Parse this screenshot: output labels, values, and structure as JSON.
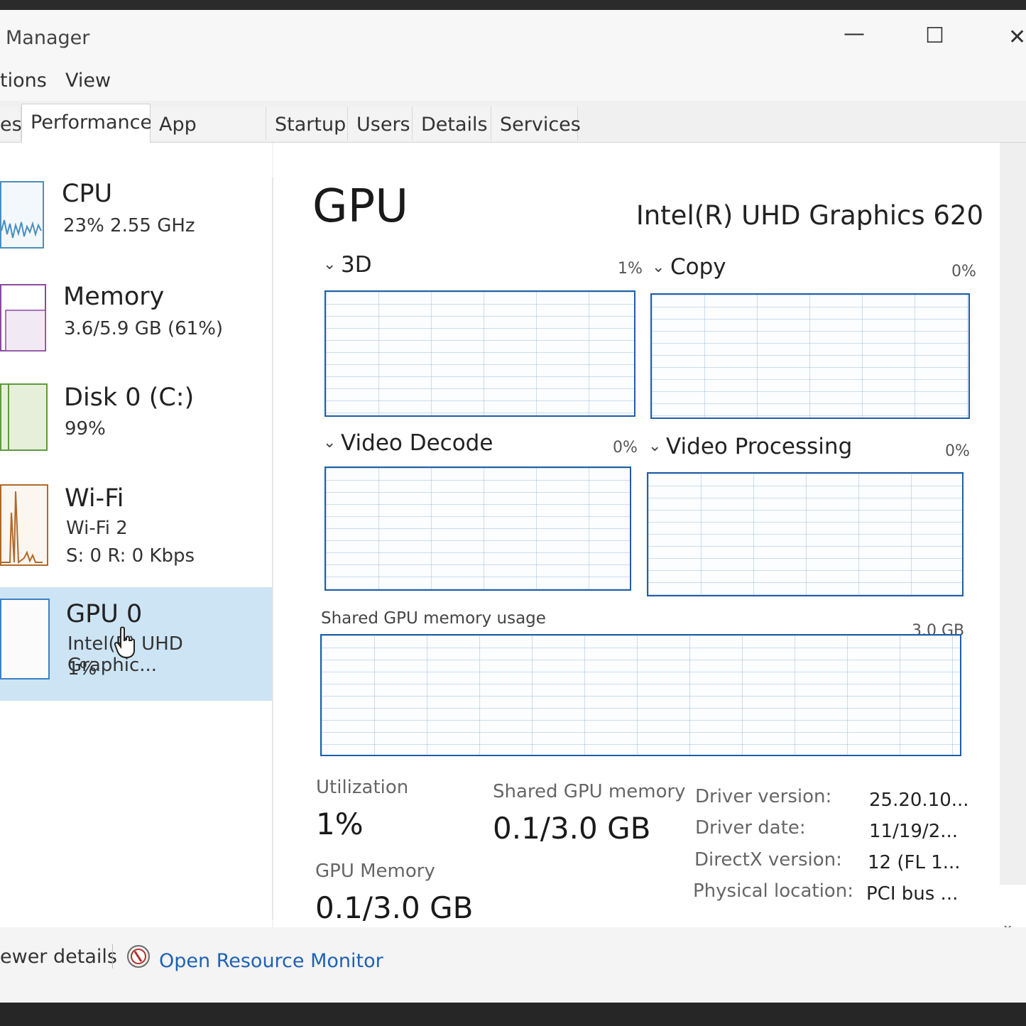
{
  "window": {
    "title": "Manager",
    "controls": {
      "minimize": "—",
      "maximize": "☐",
      "close": "✕"
    }
  },
  "menu": [
    "tions",
    "View"
  ],
  "tabs": [
    {
      "label": "es",
      "active": false
    },
    {
      "label": "Performance",
      "active": true
    },
    {
      "label": "App history",
      "active": false
    },
    {
      "label": "Startup",
      "active": false
    },
    {
      "label": "Users",
      "active": false
    },
    {
      "label": "Details",
      "active": false
    },
    {
      "label": "Services",
      "active": false
    }
  ],
  "sidebar": {
    "items": [
      {
        "name": "CPU",
        "sub1": "23%  2.55 GHz",
        "sub2": ""
      },
      {
        "name": "Memory",
        "sub1": "3.6/5.9 GB (61%)",
        "sub2": ""
      },
      {
        "name": "Disk 0 (C:)",
        "sub1": "99%",
        "sub2": ""
      },
      {
        "name": "Wi-Fi",
        "sub1": "Wi-Fi 2",
        "sub2": "S: 0 R: 0 Kbps"
      },
      {
        "name": "GPU 0",
        "sub1": "Intel(R) UHD Graphic...",
        "sub2": "1%"
      }
    ],
    "colors": {
      "cpu": "#4a8fc0",
      "memory": "#8a4aa0",
      "disk": "#5f9a3c",
      "wifi": "#b06a2a",
      "gpu": "#3b82c4",
      "selected": "#cde4f4"
    }
  },
  "main": {
    "title": "GPU",
    "model": "Intel(R) UHD Graphics 620",
    "engines": [
      {
        "label": "3D",
        "percent": "1%"
      },
      {
        "label": "Copy",
        "percent": "0%"
      },
      {
        "label": "Video Decode",
        "percent": "0%"
      },
      {
        "label": "Video Processing",
        "percent": "0%"
      }
    ],
    "shared_memory_graph": {
      "label": "Shared GPU memory usage",
      "max": "3.0 GB"
    },
    "stats": {
      "utilization_label": "Utilization",
      "utilization_value": "1%",
      "shared_label": "Shared GPU memory",
      "shared_value": "0.1/3.0 GB",
      "gpu_memory_label": "GPU Memory",
      "gpu_memory_value": "0.1/3.0 GB"
    },
    "info": [
      {
        "key": "Driver version:",
        "value": "25.20.10..."
      },
      {
        "key": "Driver date:",
        "value": "11/19/2..."
      },
      {
        "key": "DirectX version:",
        "value": "12 (FL 1..."
      },
      {
        "key": "Physical location:",
        "value": "PCI bus ..."
      }
    ]
  },
  "footer": {
    "fewer_details": "ewer details",
    "resource_monitor": "Open Resource Monitor"
  },
  "accent": "#1f5ea8"
}
